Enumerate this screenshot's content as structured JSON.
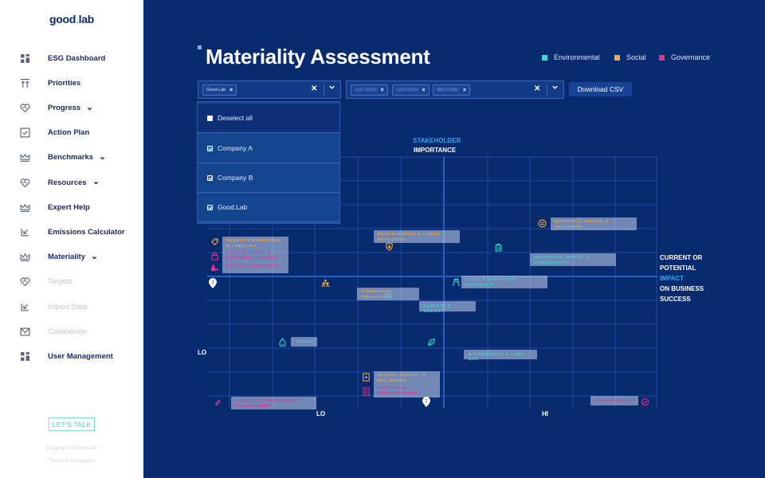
{
  "sidebar": {
    "logo_left": "good",
    "logo_right": "lab",
    "items": [
      {
        "label": "ESG Dashboard",
        "icon": "dashboard-grid-icon",
        "has_chevron": false,
        "dim": false
      },
      {
        "label": "Priorities",
        "icon": "priorities-arrows-icon",
        "has_chevron": false,
        "dim": false
      },
      {
        "label": "Progress",
        "icon": "heart-handshake-icon",
        "has_chevron": true,
        "dim": false
      },
      {
        "label": "Action Plan",
        "icon": "checkbox-icon",
        "has_chevron": false,
        "dim": false
      },
      {
        "label": "Benchmarks",
        "icon": "crown-icon",
        "has_chevron": true,
        "dim": false
      },
      {
        "label": "Resources",
        "icon": "heart-handshake-icon",
        "has_chevron": true,
        "dim": false
      },
      {
        "label": "Expert Help",
        "icon": "crown-icon",
        "has_chevron": false,
        "dim": false
      },
      {
        "label": "Emissions Calculator",
        "icon": "import-arrow-icon",
        "has_chevron": false,
        "dim": false
      },
      {
        "label": "Materiality",
        "icon": "crown-icon",
        "has_chevron": true,
        "dim": false
      },
      {
        "label": "Targets",
        "icon": "heart-handshake-icon",
        "has_chevron": false,
        "dim": true
      },
      {
        "label": "Import Data",
        "icon": "import-arrow-icon",
        "has_chevron": false,
        "dim": true
      },
      {
        "label": "Collaborate",
        "icon": "envelope-icon",
        "has_chevron": false,
        "dim": true
      },
      {
        "label": "User Management",
        "icon": "dashboard-grid-icon",
        "has_chevron": false,
        "dim": false
      }
    ],
    "chevron": "⌄",
    "cta": "LET'S TALK",
    "copyright": "Copyright © Good.Lab",
    "terms": "Terms & Conditions"
  },
  "header": {
    "title": "Materiality Assessment",
    "legend": [
      {
        "label": "Environmental",
        "color": "#2fe0cc"
      },
      {
        "label": "Social",
        "color": "#f2a93b"
      },
      {
        "label": "Governance",
        "color": "#ec2c8c"
      }
    ]
  },
  "filters": {
    "company_select": {
      "chips": [
        "Good.Lab"
      ],
      "clear": "✕",
      "chevron": "⌄"
    },
    "user_select": {
      "chips": [
        "Liam Boost",
        "Liam Boost",
        "Milo Farber"
      ],
      "clear": "✕",
      "chevron": "⌄"
    },
    "download_label": "Download CSV",
    "dropdown": {
      "items": [
        {
          "label": "Deselect all",
          "checked": false
        },
        {
          "label": "Company A",
          "checked": true
        },
        {
          "label": "Company B",
          "checked": true
        },
        {
          "label": "Good.Lab",
          "checked": true
        }
      ]
    }
  },
  "matrix": {
    "y_axis": {
      "line1": "STAKEHOLDER",
      "line2": "IMPORTANCE"
    },
    "x_axis": {
      "line1": "CURRENT OR",
      "line2": "POTENTIAL",
      "line3": "IMPACT",
      "line4": "ON BUSINESS",
      "line5": "SUCCESS"
    },
    "lo_left": "LO",
    "lo_bottom": "LO",
    "hi_bottom": "HI",
    "colors": {
      "environmental": "#2fe0cc",
      "social": "#f2a93b",
      "governance": "#ec2c8c",
      "grid": "#1d4aa0",
      "axis": "#2a5fc0",
      "background": "#082a6e"
    },
    "items": [
      {
        "label": "Product Marketing & Labeling",
        "category": "social"
      },
      {
        "label": "Data Security & Customer Privacy",
        "category": "governance"
      },
      {
        "label": "Policy & Advocacy",
        "category": "governance"
      },
      {
        "label": "Human Rights & Labor Practices",
        "category": "social"
      },
      {
        "label": "Diversity, Equity, & Inclusion",
        "category": "social"
      },
      {
        "label": "Materials, Waste, & Circularity",
        "category": "environmental"
      },
      {
        "label": "Toxic & Hazardous Materials",
        "category": "environmental"
      },
      {
        "label": "Community Relations",
        "category": "social"
      },
      {
        "label": "Climate & Energy",
        "category": "environmental"
      },
      {
        "label": "Water",
        "category": "environmental"
      },
      {
        "label": "Biodiversity & Land Use",
        "category": "environmental"
      },
      {
        "label": "Health, Safety, & Wellbeing",
        "category": "social"
      },
      {
        "label": "Corporate Accountability",
        "category": "governance"
      },
      {
        "label": "Supplier Performance Management",
        "category": "governance"
      },
      {
        "label": "Transparency",
        "category": "governance"
      }
    ],
    "pins": [
      "3",
      "2"
    ]
  }
}
